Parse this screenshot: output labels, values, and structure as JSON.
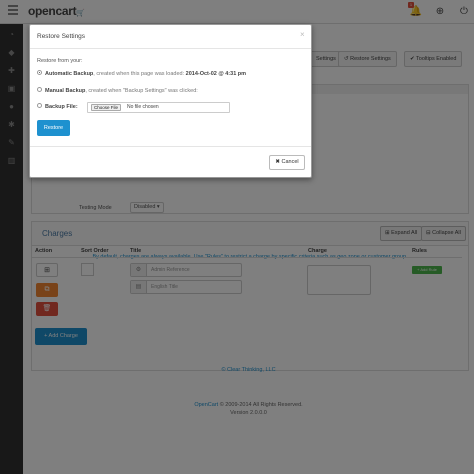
{
  "header": {
    "logo_text": "opencart",
    "notification_count": "1"
  },
  "toolbar": {
    "settings_label": "Settings",
    "restore_label": "Restore Settings",
    "tooltips_label": "Tooltips Enabled"
  },
  "form": {
    "testing_mode_label": "Testing Mode",
    "testing_mode_value": "Disabled"
  },
  "charges": {
    "title": "Charges",
    "expand_all": "Expand All",
    "collapse_all": "Collapse All",
    "description": "By default, charges are always available. Use \"Rules\" to restrict a charge by specific criteria such as geo zone or customer group.",
    "columns": [
      "Action",
      "Sort Order",
      "Title",
      "Charge",
      "Rules"
    ],
    "admin_ref_placeholder": "Admin Reference",
    "english_title_placeholder": "English Title",
    "add_rule_label": "Add Rule",
    "add_charge_label": "Add Charge"
  },
  "footer": {
    "company": "© Clear Thinking, LLC",
    "opencart_link": "OpenCart",
    "copyright": "© 2009-2014 All Rights Reserved.",
    "version": "Version 2.0.0.0"
  },
  "modal": {
    "title": "Restore Settings",
    "close": "×",
    "restore_from": "Restore from your:",
    "options": [
      {
        "label": "Automatic Backup",
        "desc": ", created when this page was loaded:",
        "date": "2014-Oct-02 @ 4:31 pm",
        "checked": true
      },
      {
        "label": "Manual Backup",
        "desc": ", created when \"Backup Settings\" was clicked:",
        "date": "",
        "checked": false
      },
      {
        "label": "Backup File:",
        "desc": "",
        "date": "",
        "checked": false
      }
    ],
    "choose_file": "Choose File",
    "no_file": "No file chosen",
    "restore_button": "Restore",
    "cancel_button": "Cancel"
  },
  "colors": {
    "primary": "#1e91cf",
    "sidebar": "#313131",
    "success": "#4cb64c",
    "warning": "#f38733",
    "danger": "#e3503e"
  }
}
